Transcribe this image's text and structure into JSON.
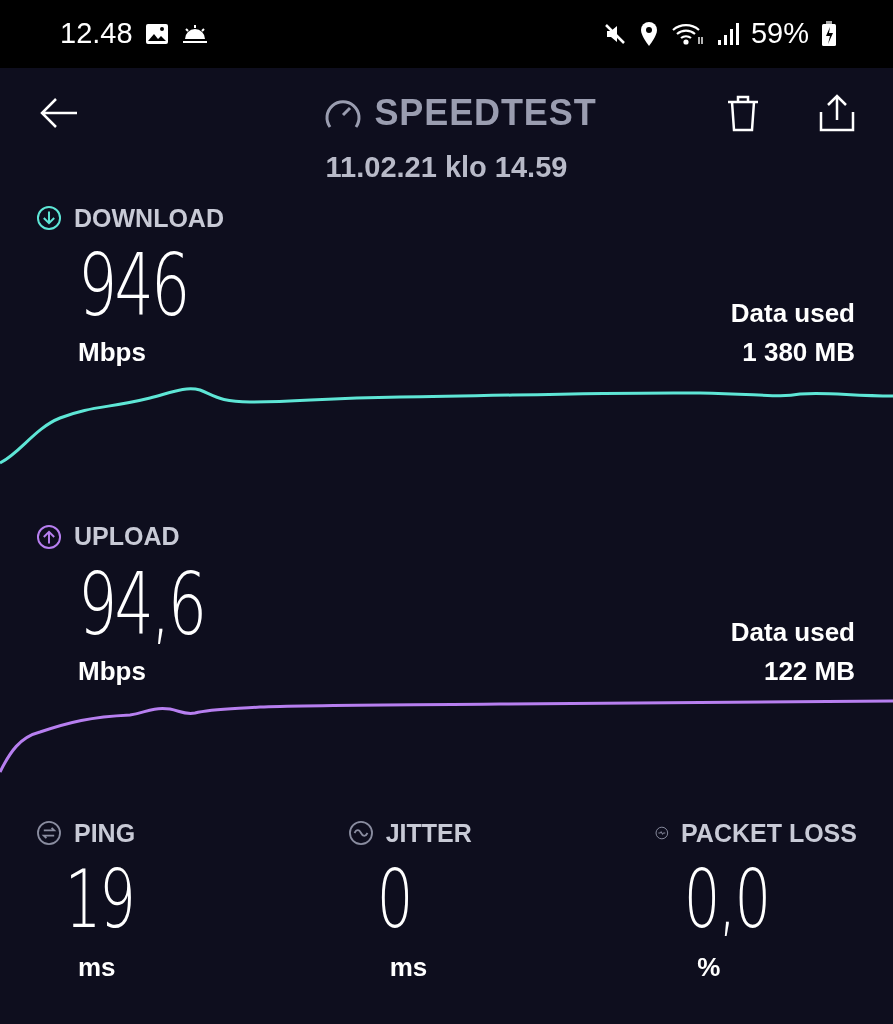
{
  "status_bar": {
    "time": "12.48",
    "battery": "59%"
  },
  "header": {
    "title": "SPEEDTEST",
    "date": "11.02.21 klo 14.59"
  },
  "tests": [
    {
      "kind": "download",
      "label": "DOWNLOAD",
      "value": "946",
      "unit": "Mbps",
      "data_used_label": "Data used",
      "data_used": "1 380 MB",
      "color": "#5ee6d6"
    },
    {
      "kind": "upload",
      "label": "UPLOAD",
      "value": "94,6",
      "unit": "Mbps",
      "data_used_label": "Data used",
      "data_used": "122 MB",
      "color": "#b77ff0"
    }
  ],
  "metrics": [
    {
      "kind": "ping",
      "label": "PING",
      "value": "19",
      "unit": "ms"
    },
    {
      "kind": "jitter",
      "label": "JITTER",
      "value": "0",
      "unit": "ms"
    },
    {
      "kind": "packet_loss",
      "label": "PACKET LOSS",
      "value": "0,0",
      "unit": "%"
    }
  ]
}
